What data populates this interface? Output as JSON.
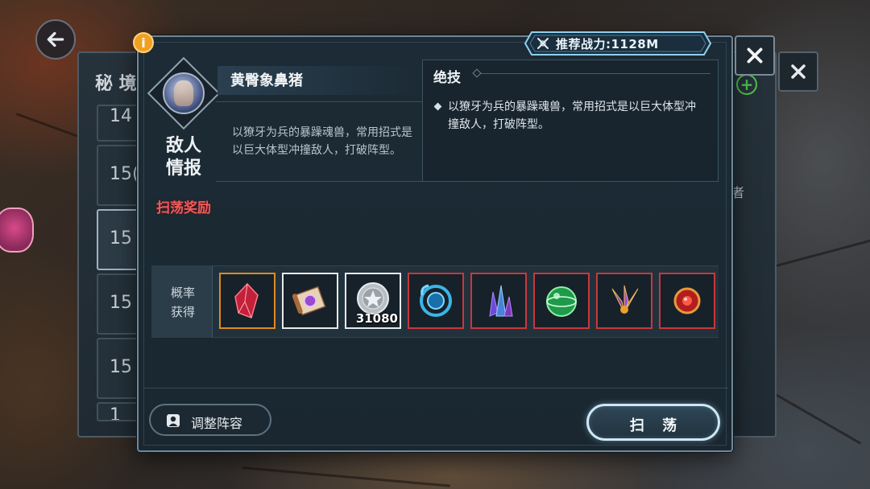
{
  "background_panel": {
    "title": "秘 境",
    "levels": [
      "14",
      "15(",
      "15",
      "15",
      "15",
      "1"
    ],
    "side_text": "者"
  },
  "dialog": {
    "recommended_power": "推荐战力:1128M",
    "enemy_info_label": "敌人\n情报",
    "enemy_name": "黄臀象鼻猪",
    "enemy_description": "以獠牙为兵的暴躁魂兽，常用招式是以巨大体型冲撞敌人，打破阵型。",
    "skill_title": "绝技",
    "skill_description": "以獠牙为兵的暴躁魂兽，常用招式是以巨大体型冲撞敌人，打破阵型。",
    "sweep_reward_label": "扫荡奖励",
    "probability_label": "概率\n获得",
    "rewards": [
      {
        "icon": "red-crystal-icon",
        "rarity": "orange",
        "quantity": ""
      },
      {
        "icon": "scroll-icon",
        "rarity": "white",
        "quantity": ""
      },
      {
        "icon": "silver-coin-icon",
        "rarity": "white",
        "quantity": "31080"
      },
      {
        "icon": "blue-orb-icon",
        "rarity": "red",
        "quantity": ""
      },
      {
        "icon": "purple-crystal-icon",
        "rarity": "red",
        "quantity": ""
      },
      {
        "icon": "green-orb-icon",
        "rarity": "red",
        "quantity": ""
      },
      {
        "icon": "purple-flower-icon",
        "rarity": "red",
        "quantity": ""
      },
      {
        "icon": "red-eye-orb-icon",
        "rarity": "red",
        "quantity": ""
      }
    ],
    "adjust_lineup_label": "调整阵容",
    "sweep_button_label": "扫 荡"
  },
  "colors": {
    "rarity_orange": "#e08a22",
    "rarity_red": "#c9373c",
    "rarity_white": "#e6eaee",
    "reward_label_red": "#ef5a5a"
  }
}
